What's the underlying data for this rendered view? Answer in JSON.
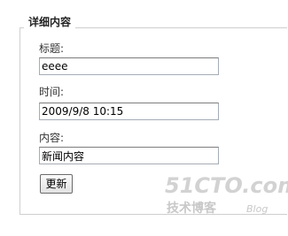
{
  "form": {
    "legend": "详细内容",
    "fields": [
      {
        "label": "标题:",
        "value": "eeee"
      },
      {
        "label": "时间:",
        "value": "2009/9/8 10:15"
      },
      {
        "label": "内容:",
        "value": "新闻内容"
      }
    ],
    "submit_label": "更新"
  },
  "watermark": {
    "logo": "51CTO.com",
    "subtitle": "技术博客",
    "blog": "Blog"
  }
}
